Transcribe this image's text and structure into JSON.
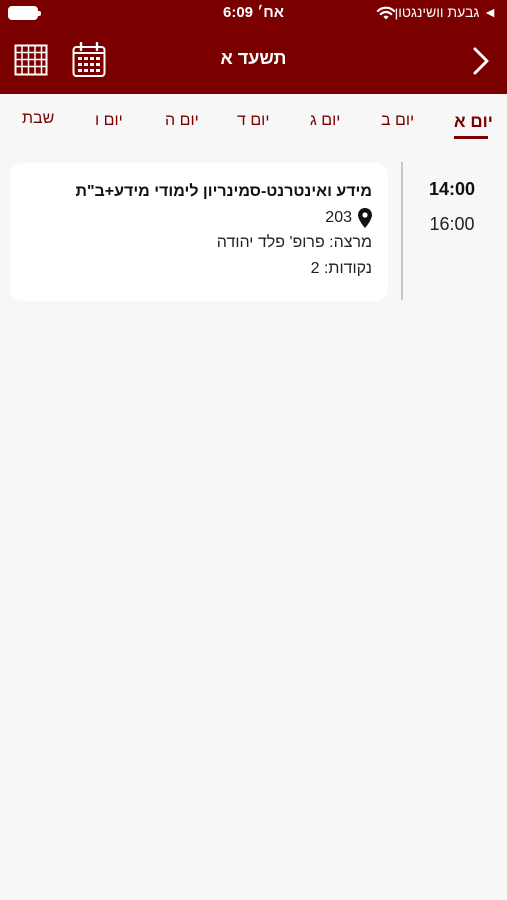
{
  "status_bar": {
    "carrier": "גבעת וושינגטון",
    "time": "6:09 אח׳"
  },
  "nav": {
    "title": "תשעד א"
  },
  "days": [
    {
      "label": "יום א",
      "active": true
    },
    {
      "label": "יום ב",
      "active": false
    },
    {
      "label": "יום ג",
      "active": false
    },
    {
      "label": "יום ד",
      "active": false
    },
    {
      "label": "יום ה",
      "active": false
    },
    {
      "label": "יום ו",
      "active": false
    },
    {
      "label": "שבת",
      "active": false
    }
  ],
  "schedule": [
    {
      "start": "14:00",
      "end": "16:00",
      "title": "מידע ואינטרנט-סמינריון לימודי מידע+ב\"ת",
      "room": "203",
      "lecturer": "מרצה: פרופ' פלד יהודה",
      "credits": "נקודות: 2"
    }
  ],
  "colors": {
    "brand": "#7a0000",
    "background": "#f7f7f7",
    "card": "#ffffff"
  },
  "icons": [
    "battery-icon",
    "wifi-icon",
    "grid-icon",
    "calendar-icon",
    "back-chevron-icon",
    "location-pin-icon",
    "location-arrow-icon"
  ]
}
